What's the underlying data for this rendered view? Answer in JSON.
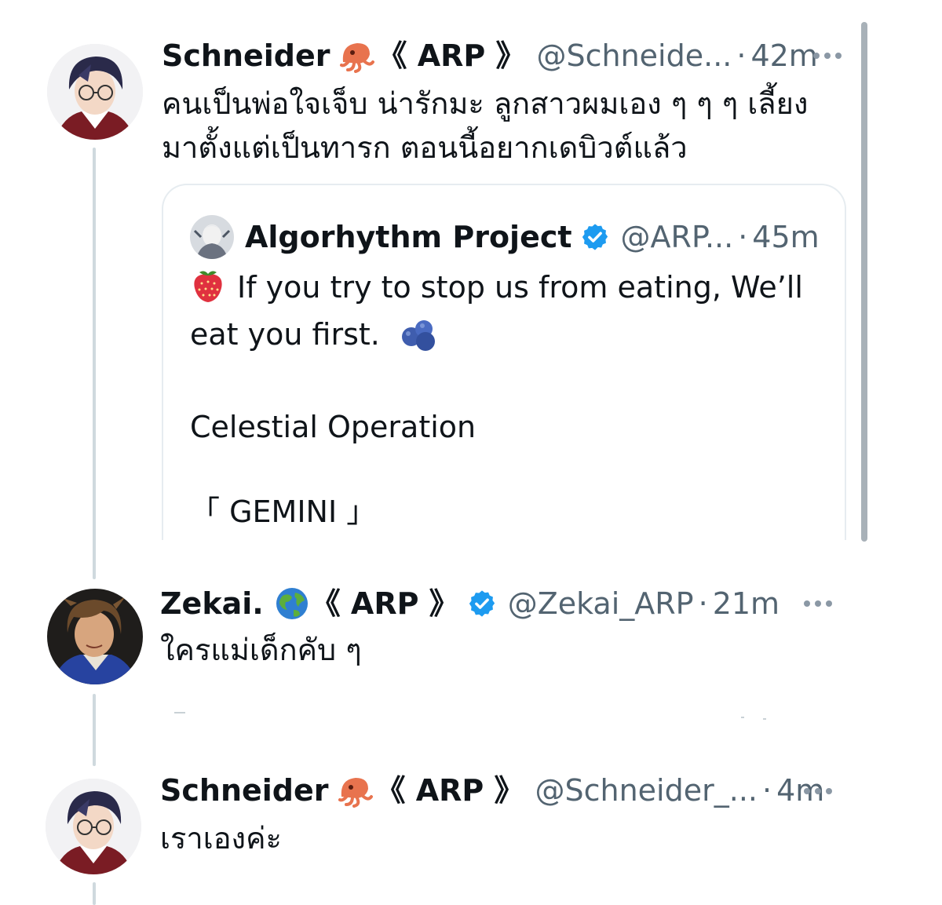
{
  "tweets": [
    {
      "name": "Schneider",
      "emoji": "squid",
      "tag": "《 ARP 》",
      "handle": "@Schneide...",
      "separator": "·",
      "time": "42m",
      "text": "คนเป็นพ่อใจเจ็บ น่ารักมะ ลูกสาวผมเอง ๆ ๆ ๆ เลี้ยง\nมาตั้งแต่เป็นทารก ตอนนี้อยากเดบิวต์แล้ว",
      "quote": {
        "name": "Algorhythm Project",
        "verified": true,
        "handle": "@ARP...",
        "separator": "·",
        "time": "45m",
        "line1": "If you try to stop us from eating, We’ll",
        "line2": "eat you first.",
        "line3": "Celestial Operation",
        "line4": "「 GEMINI 」",
        "emoji_start": "strawberry",
        "emoji_end": "blueberries"
      }
    },
    {
      "name": "Zekai.",
      "emoji": "globe",
      "tag": "《 ARP 》",
      "verified": true,
      "handle": "@Zekai_ARP",
      "separator": "·",
      "time": "21m",
      "text": "ใครแม่เด็กคับ ๆ"
    },
    {
      "name": "Schneider",
      "emoji": "squid",
      "tag": "《 ARP 》",
      "handle": "@Schneider_...",
      "separator": "·",
      "time": "4m",
      "text": "เราเองค่ะ"
    }
  ],
  "colors": {
    "text_primary": "#0f1419",
    "text_secondary": "#536471",
    "verified_blue": "#1d9bf0",
    "thread_line": "#cfd9de",
    "border": "#e6ecf0"
  }
}
